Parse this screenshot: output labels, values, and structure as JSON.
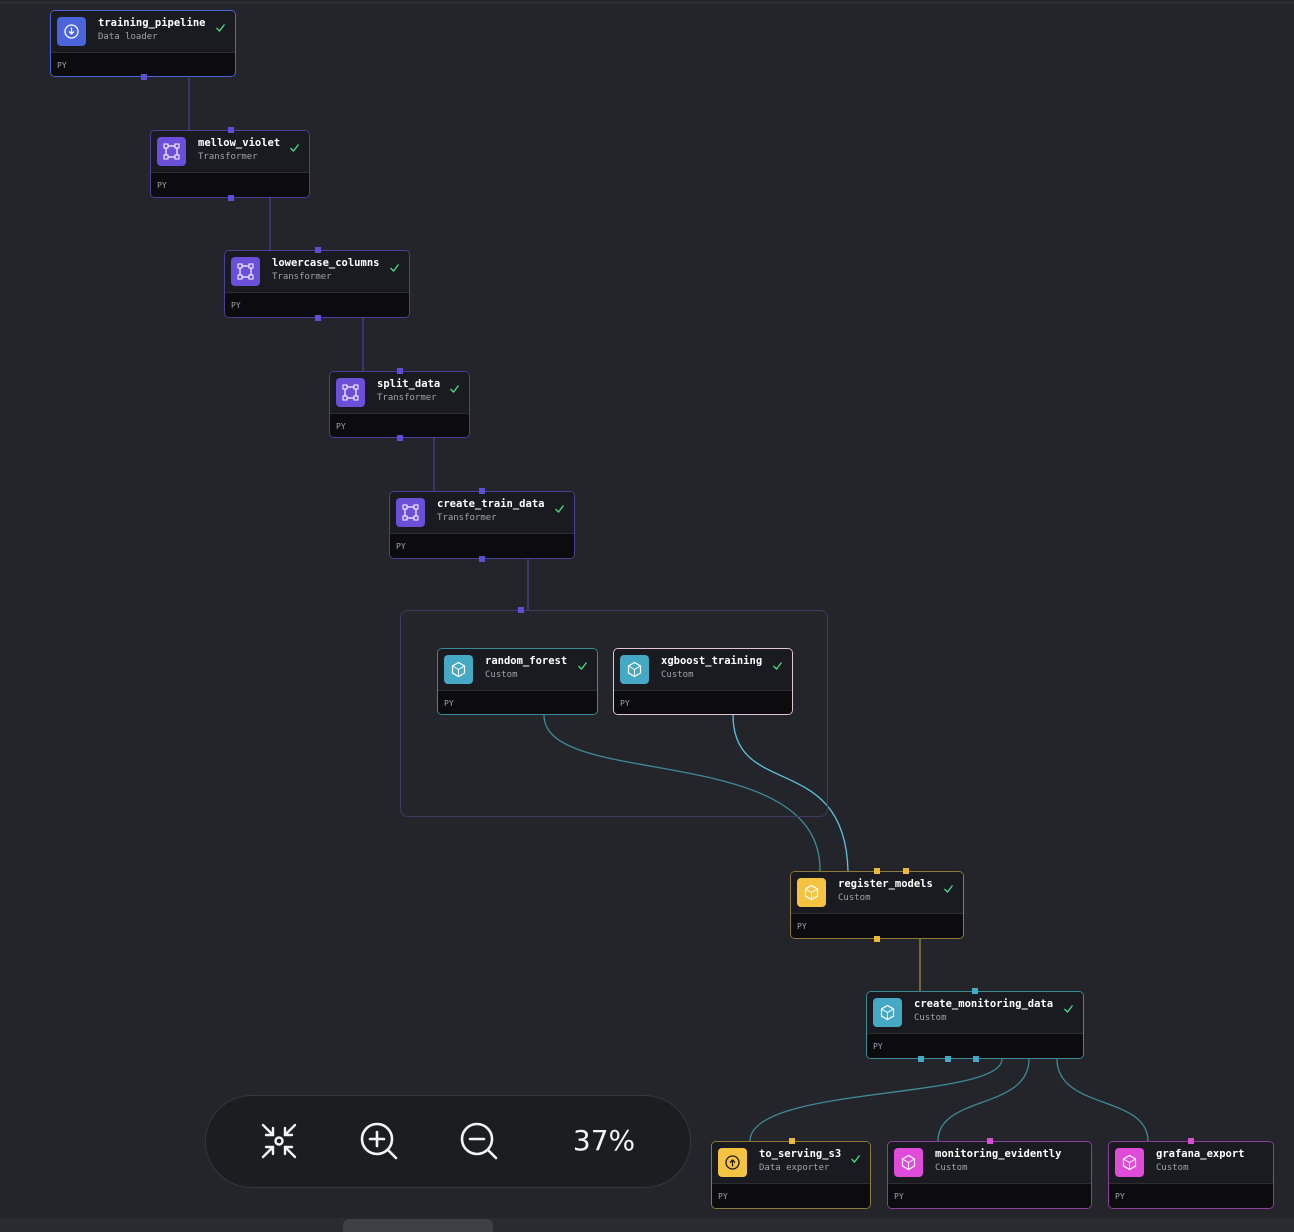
{
  "pipeline": {
    "blocks": [
      {
        "id": "training_pipeline",
        "name": "training_pipeline",
        "type": "Data loader",
        "lang": "PY",
        "status": "success",
        "color": "#4c64d9"
      },
      {
        "id": "mellow_violet",
        "name": "mellow_violet",
        "type": "Transformer",
        "lang": "PY",
        "status": "success",
        "color": "#6b4fd8"
      },
      {
        "id": "lowercase_columns",
        "name": "lowercase_columns",
        "type": "Transformer",
        "lang": "PY",
        "status": "success",
        "color": "#6b4fd8"
      },
      {
        "id": "split_data",
        "name": "split_data",
        "type": "Transformer",
        "lang": "PY",
        "status": "success",
        "color": "#6b4fd8"
      },
      {
        "id": "create_train_data",
        "name": "create_train_data",
        "type": "Transformer",
        "lang": "PY",
        "status": "success",
        "color": "#6b4fd8"
      },
      {
        "id": "random_forest",
        "name": "random_forest",
        "type": "Custom",
        "lang": "PY",
        "status": "success",
        "color": "#45a8c4"
      },
      {
        "id": "xgboost_training",
        "name": "xgboost_training",
        "type": "Custom",
        "lang": "PY",
        "status": "success",
        "color": "#45a8c4"
      },
      {
        "id": "register_models",
        "name": "register_models",
        "type": "Custom",
        "lang": "PY",
        "status": "success",
        "color": "#f5c342"
      },
      {
        "id": "create_monitoring_data",
        "name": "create_monitoring_data",
        "type": "Custom",
        "lang": "PY",
        "status": "success",
        "color": "#45a8c4"
      },
      {
        "id": "to_serving_s3",
        "name": "to_serving_s3",
        "type": "Data exporter",
        "lang": "PY",
        "status": "success",
        "color": "#f5c342"
      },
      {
        "id": "monitoring_evidently",
        "name": "monitoring_evidently",
        "type": "Custom",
        "lang": "PY",
        "status": "none",
        "color": "#e04cd9"
      },
      {
        "id": "grafana_export",
        "name": "grafana_export",
        "type": "Custom",
        "lang": "PY",
        "status": "none",
        "color": "#e04cd9"
      }
    ]
  },
  "zoom": {
    "level": "37%",
    "fit_icon": "fit-view-icon",
    "zoom_in_icon": "zoom-in-icon",
    "zoom_out_icon": "zoom-out-icon"
  },
  "colors": {
    "background": "#24252a",
    "edge_violet": "#4b3f94",
    "edge_teal": "#3d8a99",
    "edge_yellow": "#9c8a3a",
    "check": "#4ade80"
  }
}
